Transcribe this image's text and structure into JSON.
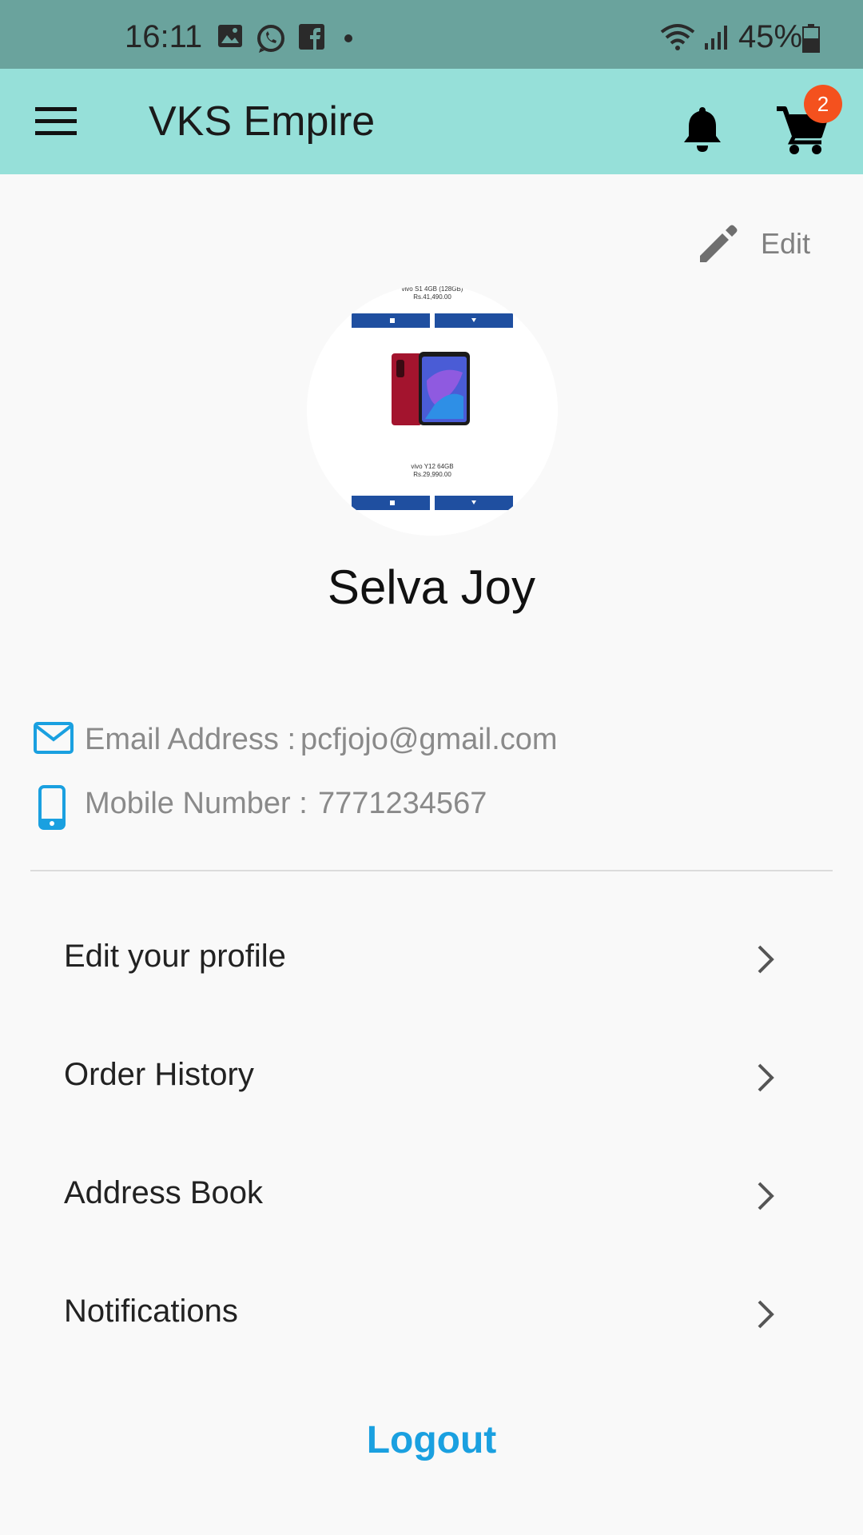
{
  "status_bar": {
    "time": "16:11",
    "battery": "45%"
  },
  "app_bar": {
    "title": "VKS Empire",
    "cart_count": "2"
  },
  "profile": {
    "edit_label": "Edit",
    "name": "Selva Joy",
    "avatar_texts": {
      "top_name": "vivo S1 4GB (128GB)",
      "top_price": "Rs.41,490.00",
      "bottom_name": "vivo Y12 64GB",
      "bottom_price": "Rs.29,990.00"
    }
  },
  "contact": {
    "email_label": "Email Address :",
    "email_value": "pcfjojo@gmail.com",
    "mobile_label": "Mobile Number :",
    "mobile_value": "7771234567"
  },
  "menu": {
    "items": [
      {
        "label": "Edit your profile"
      },
      {
        "label": "Order History"
      },
      {
        "label": "Address Book"
      },
      {
        "label": "Notifications"
      }
    ]
  },
  "logout_label": "Logout",
  "colors": {
    "status_bar": "#6aa39d",
    "app_bar": "#96e0d9",
    "accent": "#1aa0e0",
    "badge": "#f4511e"
  }
}
